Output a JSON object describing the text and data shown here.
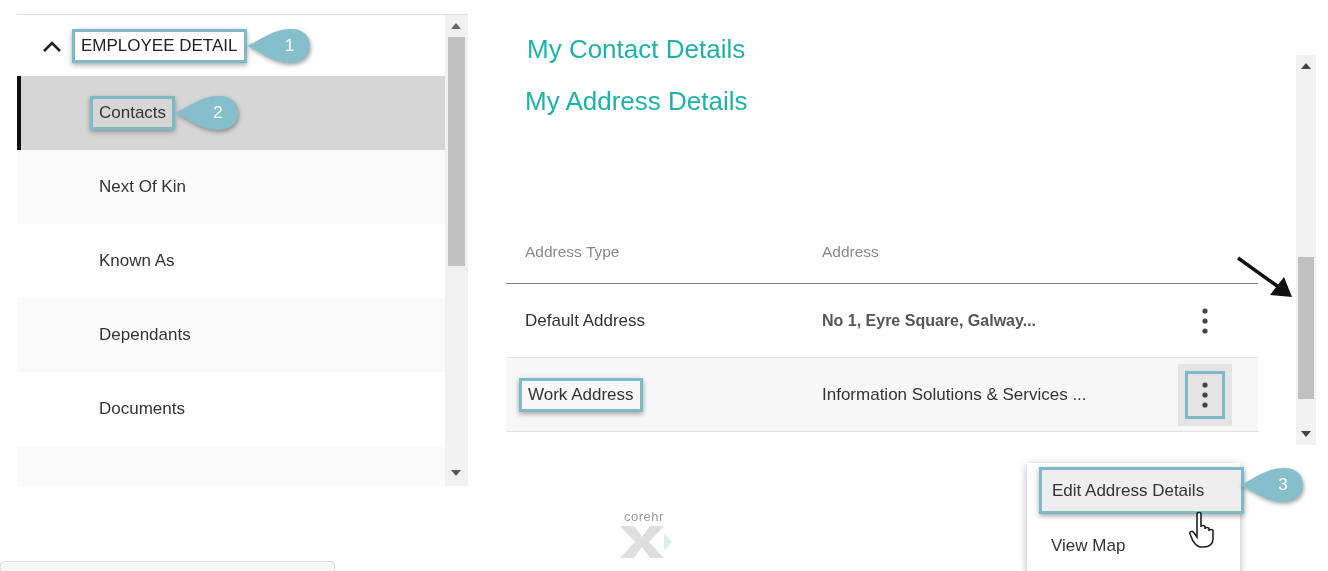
{
  "sidebar": {
    "section": {
      "label": "EMPLOYEE DETAIL",
      "expanded": true,
      "highlighted": true,
      "callout": "1"
    },
    "items": [
      {
        "label": "Contacts",
        "selected": true,
        "highlighted": true,
        "callout": "2"
      },
      {
        "label": "Next Of Kin",
        "selected": false,
        "highlighted": false
      },
      {
        "label": "Known As",
        "selected": false,
        "highlighted": false
      },
      {
        "label": "Dependants",
        "selected": false,
        "highlighted": false
      },
      {
        "label": "Documents",
        "selected": false,
        "highlighted": false
      }
    ]
  },
  "contact_title": "My Contact Details",
  "address_title": "My Address Details",
  "table": {
    "columns": [
      "Address Type",
      "Address"
    ],
    "rows": [
      {
        "type": "Default Address",
        "address": "No 1, Eyre Square, Galway...",
        "bold": true,
        "highlighted": false,
        "menu_open": false
      },
      {
        "type": "Work Address",
        "address": "Information Solutions & Services ...",
        "bold": false,
        "highlighted": true,
        "menu_open": true
      }
    ]
  },
  "menu": {
    "items": [
      {
        "label": "Edit Address Details",
        "hovered": true,
        "highlighted": true,
        "callout": "3"
      },
      {
        "label": "View Map",
        "hovered": false,
        "highlighted": false
      }
    ]
  },
  "logo": "corehr"
}
